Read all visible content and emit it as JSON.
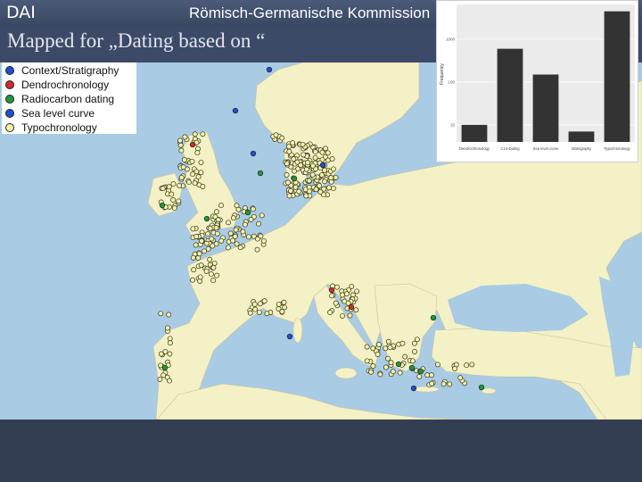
{
  "header": {
    "logo_text": "DAI",
    "institution": "Römisch-Germanische Kommission"
  },
  "slide": {
    "title": "Mapped for „Dating based on “"
  },
  "legend": {
    "items": [
      {
        "label": "Context/Stratigraphy",
        "color": "#1f4fd1"
      },
      {
        "label": "Dendrochronology",
        "color": "#d42a2a"
      },
      {
        "label": "Radiocarbon dating",
        "color": "#1d9a3a"
      },
      {
        "label": "Sea level curve",
        "color": "#1f4fd1"
      },
      {
        "label": "Typochronology",
        "color": "#f4f4a2"
      }
    ]
  },
  "colors": {
    "sea": "#a9cbe4",
    "land": "#f4f1c6",
    "header_bg": "#3a4762",
    "footer_bg": "#333e52",
    "bar_fill": "#333333"
  },
  "chart_data": {
    "type": "bar",
    "categories": [
      "Dendrochronology",
      "C14-Dating",
      "Sea level curve",
      "Stratigraphy",
      "Typochronology"
    ],
    "values": [
      10,
      600,
      150,
      7,
      4500
    ],
    "ylabel": "Frequency",
    "log_scale": true,
    "yticks": [
      10,
      100,
      1000
    ],
    "ylim": [
      4,
      6500
    ],
    "grid": true
  },
  "map_points": {
    "note": ""
  }
}
